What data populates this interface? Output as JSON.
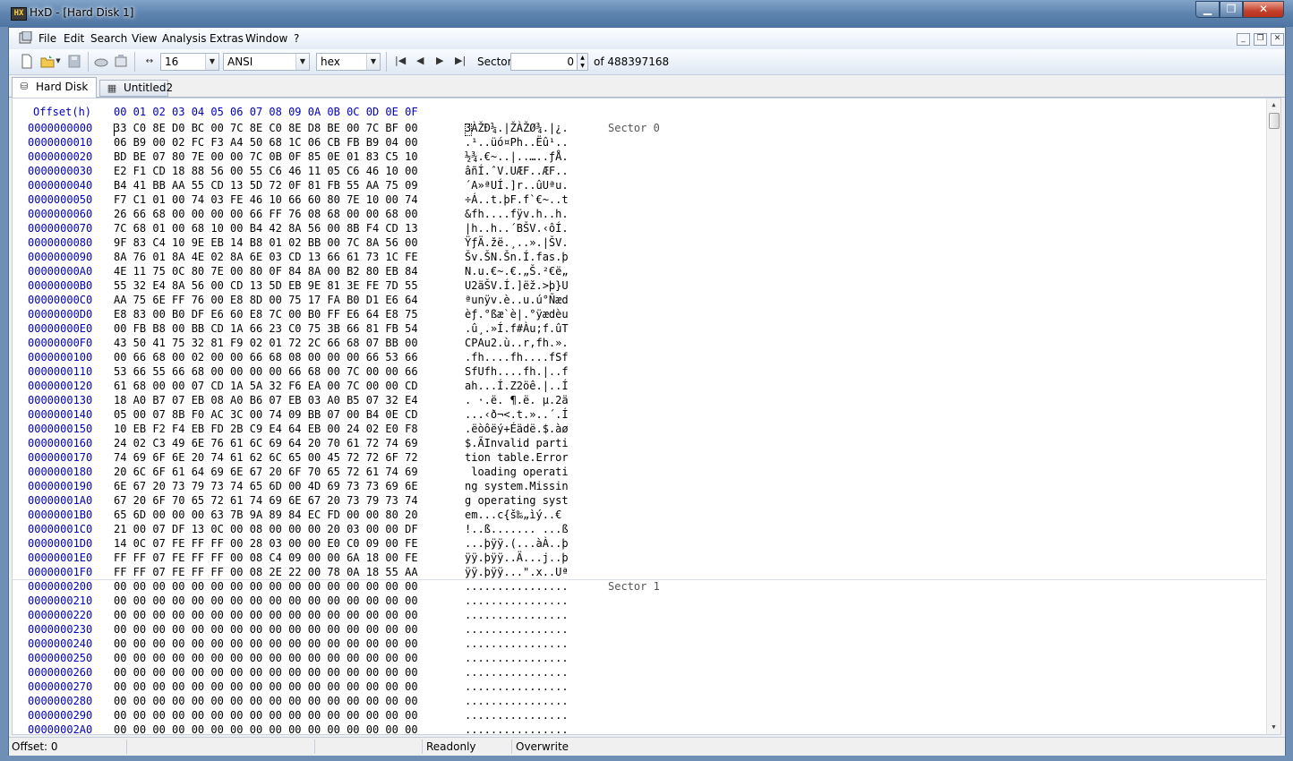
{
  "window": {
    "title": "HxD - [Hard Disk 1]",
    "icon": "hxd-app-icon"
  },
  "menu": {
    "items": [
      "File",
      "Edit",
      "Search",
      "View",
      "Analysis",
      "Extras",
      "Window",
      "?"
    ]
  },
  "toolbar": {
    "bytes_per_row": "16",
    "charset": "ANSI",
    "offset_base": "hex",
    "sector_label": "Sector",
    "sector_value": "0",
    "sector_total": "of 488397168"
  },
  "tabs": [
    {
      "label": "Hard Disk 1",
      "active": true,
      "icon": "disk-icon"
    },
    {
      "label": "Untitled2",
      "active": false,
      "icon": "file-icon"
    }
  ],
  "hex": {
    "offset_header": "Offset(h)",
    "column_header": "00 01 02 03 04 05 06 07 08 09 0A 0B 0C 0D 0E 0F",
    "sector0_label": "Sector 0",
    "sector1_label": "Sector 1",
    "rows": [
      {
        "off": "0000000000",
        "hex": "33 C0 8E D0 BC 00 7C 8E C0 8E D8 BE 00 7C BF 00",
        "asc": "3ÀŽÐ¼.|ŽÀŽØ¾.|¿."
      },
      {
        "off": "0000000010",
        "hex": "06 B9 00 02 FC F3 A4 50 68 1C 06 CB FB B9 04 00",
        "asc": ".¹..üó¤Ph..Ëû¹.."
      },
      {
        "off": "0000000020",
        "hex": "BD BE 07 80 7E 00 00 7C 0B 0F 85 0E 01 83 C5 10",
        "asc": "½¾.€~..|..…..ƒÅ."
      },
      {
        "off": "0000000030",
        "hex": "E2 F1 CD 18 88 56 00 55 C6 46 11 05 C6 46 10 00",
        "asc": "âñÍ.ˆV.UÆF..ÆF.."
      },
      {
        "off": "0000000040",
        "hex": "B4 41 BB AA 55 CD 13 5D 72 0F 81 FB 55 AA 75 09",
        "asc": "´A»ªUÍ.]r..ûUªu."
      },
      {
        "off": "0000000050",
        "hex": "F7 C1 01 00 74 03 FE 46 10 66 60 80 7E 10 00 74",
        "asc": "÷Á..t.þF.f`€~..t"
      },
      {
        "off": "0000000060",
        "hex": "26 66 68 00 00 00 00 66 FF 76 08 68 00 00 68 00",
        "asc": "&fh....fÿv.h..h."
      },
      {
        "off": "0000000070",
        "hex": "7C 68 01 00 68 10 00 B4 42 8A 56 00 8B F4 CD 13",
        "asc": "|h..h..´BŠV.‹ôÍ."
      },
      {
        "off": "0000000080",
        "hex": "9F 83 C4 10 9E EB 14 B8 01 02 BB 00 7C 8A 56 00",
        "asc": "ŸƒÄ.žë.¸..».|ŠV."
      },
      {
        "off": "0000000090",
        "hex": "8A 76 01 8A 4E 02 8A 6E 03 CD 13 66 61 73 1C FE",
        "asc": "Šv.ŠN.Šn.Í.fas.þ"
      },
      {
        "off": "00000000A0",
        "hex": "4E 11 75 0C 80 7E 00 80 0F 84 8A 00 B2 80 EB 84",
        "asc": "N.u.€~.€.„Š.²€ë„"
      },
      {
        "off": "00000000B0",
        "hex": "55 32 E4 8A 56 00 CD 13 5D EB 9E 81 3E FE 7D 55",
        "asc": "U2äŠV.Í.]ëž.>þ}U"
      },
      {
        "off": "00000000C0",
        "hex": "AA 75 6E FF 76 00 E8 8D 00 75 17 FA B0 D1 E6 64",
        "asc": "ªunÿv.è..u.ú°Ñæd"
      },
      {
        "off": "00000000D0",
        "hex": "E8 83 00 B0 DF E6 60 E8 7C 00 B0 FF E6 64 E8 75",
        "asc": "èƒ.°ßæ`è|.°ÿædèu"
      },
      {
        "off": "00000000E0",
        "hex": "00 FB B8 00 BB CD 1A 66 23 C0 75 3B 66 81 FB 54",
        "asc": ".û¸.»Í.f#Àu;f.ûT"
      },
      {
        "off": "00000000F0",
        "hex": "43 50 41 75 32 81 F9 02 01 72 2C 66 68 07 BB 00",
        "asc": "CPAu2.ù..r,fh.»."
      },
      {
        "off": "0000000100",
        "hex": "00 66 68 00 02 00 00 66 68 08 00 00 00 66 53 66",
        "asc": ".fh....fh....fSf"
      },
      {
        "off": "0000000110",
        "hex": "53 66 55 66 68 00 00 00 00 66 68 00 7C 00 00 66",
        "asc": "SfUfh....fh.|..f"
      },
      {
        "off": "0000000120",
        "hex": "61 68 00 00 07 CD 1A 5A 32 F6 EA 00 7C 00 00 CD",
        "asc": "ah...Í.Z2öê.|..Í"
      },
      {
        "off": "0000000130",
        "hex": "18 A0 B7 07 EB 08 A0 B6 07 EB 03 A0 B5 07 32 E4",
        "asc": ". ·.ë. ¶.ë. µ.2ä"
      },
      {
        "off": "0000000140",
        "hex": "05 00 07 8B F0 AC 3C 00 74 09 BB 07 00 B4 0E CD",
        "asc": "...‹ð¬<.t.»..´.Í"
      },
      {
        "off": "0000000150",
        "hex": "10 EB F2 F4 EB FD 2B C9 E4 64 EB 00 24 02 E0 F8",
        "asc": ".ëòôëý+Éädë.$.àø"
      },
      {
        "off": "0000000160",
        "hex": "24 02 C3 49 6E 76 61 6C 69 64 20 70 61 72 74 69",
        "asc": "$.ÃInvalid parti"
      },
      {
        "off": "0000000170",
        "hex": "74 69 6F 6E 20 74 61 62 6C 65 00 45 72 72 6F 72",
        "asc": "tion table.Error"
      },
      {
        "off": "0000000180",
        "hex": "20 6C 6F 61 64 69 6E 67 20 6F 70 65 72 61 74 69",
        "asc": " loading operati"
      },
      {
        "off": "0000000190",
        "hex": "6E 67 20 73 79 73 74 65 6D 00 4D 69 73 73 69 6E",
        "asc": "ng system.Missin"
      },
      {
        "off": "00000001A0",
        "hex": "67 20 6F 70 65 72 61 74 69 6E 67 20 73 79 73 74",
        "asc": "g operating syst"
      },
      {
        "off": "00000001B0",
        "hex": "65 6D 00 00 00 63 7B 9A 89 84 EC FD 00 00 80 20",
        "asc": "em...c{š‰„ìý..€ "
      },
      {
        "off": "00000001C0",
        "hex": "21 00 07 DF 13 0C 00 08 00 00 00 20 03 00 00 DF",
        "asc": "!..ß....... ...ß"
      },
      {
        "off": "00000001D0",
        "hex": "14 0C 07 FE FF FF 00 28 03 00 00 E0 C0 09 00 FE",
        "asc": "...þÿÿ.(...àÀ..þ"
      },
      {
        "off": "00000001E0",
        "hex": "FF FF 07 FE FF FF 00 08 C4 09 00 00 6A 18 00 FE",
        "asc": "ÿÿ.þÿÿ..Ä...j..þ"
      },
      {
        "off": "00000001F0",
        "hex": "FF FF 07 FE FF FF 00 08 2E 22 00 78 0A 18 55 AA",
        "asc": "ÿÿ.þÿÿ...\".x..Uª"
      },
      {
        "off": "0000000200",
        "hex": "00 00 00 00 00 00 00 00 00 00 00 00 00 00 00 00",
        "asc": "................"
      },
      {
        "off": "0000000210",
        "hex": "00 00 00 00 00 00 00 00 00 00 00 00 00 00 00 00",
        "asc": "................"
      },
      {
        "off": "0000000220",
        "hex": "00 00 00 00 00 00 00 00 00 00 00 00 00 00 00 00",
        "asc": "................"
      },
      {
        "off": "0000000230",
        "hex": "00 00 00 00 00 00 00 00 00 00 00 00 00 00 00 00",
        "asc": "................"
      },
      {
        "off": "0000000240",
        "hex": "00 00 00 00 00 00 00 00 00 00 00 00 00 00 00 00",
        "asc": "................"
      },
      {
        "off": "0000000250",
        "hex": "00 00 00 00 00 00 00 00 00 00 00 00 00 00 00 00",
        "asc": "................"
      },
      {
        "off": "0000000260",
        "hex": "00 00 00 00 00 00 00 00 00 00 00 00 00 00 00 00",
        "asc": "................"
      },
      {
        "off": "0000000270",
        "hex": "00 00 00 00 00 00 00 00 00 00 00 00 00 00 00 00",
        "asc": "................"
      },
      {
        "off": "0000000280",
        "hex": "00 00 00 00 00 00 00 00 00 00 00 00 00 00 00 00",
        "asc": "................"
      },
      {
        "off": "0000000290",
        "hex": "00 00 00 00 00 00 00 00 00 00 00 00 00 00 00 00",
        "asc": "................"
      },
      {
        "off": "00000002A0",
        "hex": "00 00 00 00 00 00 00 00 00 00 00 00 00 00 00 00",
        "asc": "................"
      }
    ]
  },
  "status": {
    "offset": "Offset: 0",
    "mode": "Readonly",
    "write_mode": "Overwrite"
  }
}
